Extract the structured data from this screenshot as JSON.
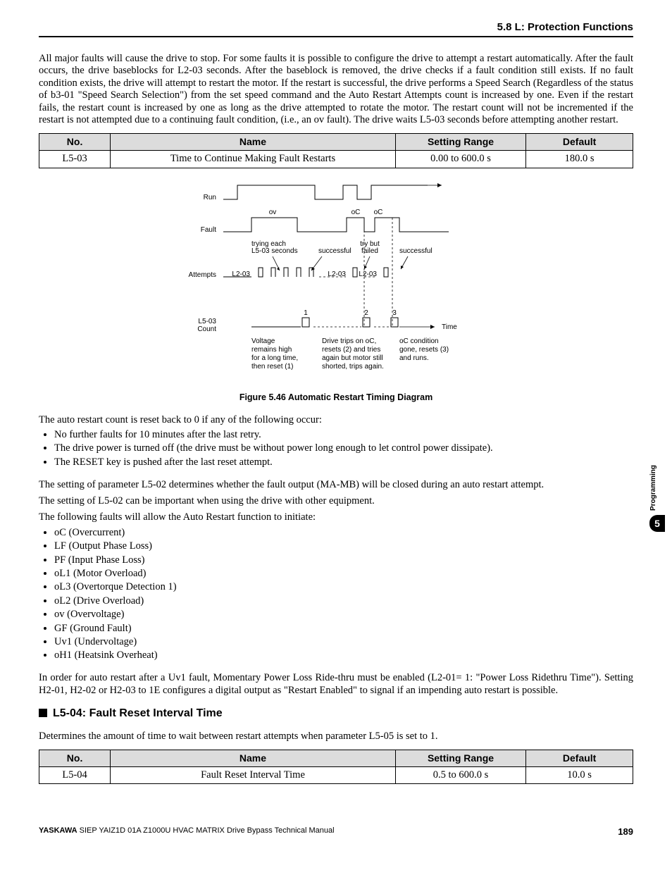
{
  "running_head": "5.8 L: Protection Functions",
  "intro_paragraph": "All major faults will cause the drive to stop. For some faults it is possible to configure the drive to attempt a restart automatically. After the fault occurs, the drive baseblocks for L2-03 seconds. After the baseblock is removed, the drive checks if a fault condition still exists. If no fault condition exists, the drive will attempt to restart the motor. If the restart is successful, the drive performs a Speed Search (Regardless of the status of b3-01 \"Speed Search Selection\") from the set speed command and the Auto Restart Attempts count is increased by one. Even if the restart fails, the restart count is increased by one as long as the drive attempted to rotate the motor. The restart count will not be incremented if the restart is not attempted due to a continuing fault condition, (i.e., an ov fault). The drive waits L5-03 seconds before attempting another restart.",
  "table1": {
    "headers": {
      "no": "No.",
      "name": "Name",
      "range": "Setting Range",
      "default": "Default"
    },
    "row": {
      "no": "L5-03",
      "name": "Time to Continue Making Fault Restarts",
      "range": "0.00 to 600.0 s",
      "default": "180.0 s"
    }
  },
  "diagram": {
    "row_labels": {
      "run": "Run",
      "fault": "Fault",
      "attempts": "Attempts",
      "count": "L5-03\nCount"
    },
    "top_labels": {
      "ov": "ov",
      "oc1": "oC",
      "oc2": "oC"
    },
    "mid_labels": {
      "trying": "trying each\nL5-03 seconds",
      "successful1": "successful",
      "trybut": "try but\nfailed",
      "successful2": "successful",
      "l2a": "L2-03",
      "l2b": "L2-03",
      "l2c": "L2-03"
    },
    "count_nums": {
      "n1": "1",
      "n2": "2",
      "n3": "3"
    },
    "time": "Time",
    "captions": {
      "c1": "Voltage\nremains high\nfor a long time,\nthen reset (1)",
      "c2": "Drive trips on oC,\nresets (2) and tries\nagain but motor still\nshorted, trips again.",
      "c3": "oC condition\ngone, resets (3)\nand runs."
    }
  },
  "figure_caption": "Figure 5.46  Automatic Restart Timing Diagram",
  "after_fig_intro": "The auto restart count is reset back to 0 if any of the following occur:",
  "reset_bullets": [
    "No further faults for 10 minutes after the last retry.",
    "The drive power is turned off (the drive must be without power long enough to let control power dissipate).",
    "The RESET key is pushed after the last reset attempt."
  ],
  "l502_line1": "The setting of parameter L5-02 determines whether the fault output (MA-MB) will be closed during an auto restart attempt.",
  "l502_line2": "The setting of L5-02 can be important when using the drive with other equipment.",
  "faults_intro": "The following faults will allow the Auto Restart function to initiate:",
  "fault_bullets": [
    "oC (Overcurrent)",
    "LF (Output Phase Loss)",
    "PF (Input Phase Loss)",
    "oL1 (Motor Overload)",
    "oL3 (Overtorque Detection 1)",
    "oL2 (Drive Overload)",
    "ov (Overvoltage)",
    "GF (Ground Fault)",
    "Uv1 (Undervoltage)",
    "oH1 (Heatsink Overheat)"
  ],
  "uv1_note": "In order for auto restart after a Uv1 fault, Momentary Power Loss Ride-thru must be enabled (L2-01= 1: \"Power Loss Ridethru Time\"). Setting H2-01, H2-02 or H2-03 to 1E configures a digital output as \"Restart Enabled\" to signal if an impending auto restart is possible.",
  "section2": {
    "heading": "L5-04: Fault Reset Interval Time",
    "body": "Determines the amount of time to wait between restart attempts when parameter L5-05 is set to 1."
  },
  "table2": {
    "headers": {
      "no": "No.",
      "name": "Name",
      "range": "Setting Range",
      "default": "Default"
    },
    "row": {
      "no": "L5-04",
      "name": "Fault Reset Interval Time",
      "range": "0.5 to 600.0 s",
      "default": "10.0 s"
    }
  },
  "side": {
    "label": "Programming",
    "num": "5"
  },
  "footer": {
    "left_bold": "YASKAWA",
    "left_rest": " SIEP YAIZ1D 01A Z1000U HVAC MATRIX Drive Bypass Technical Manual",
    "page": "189"
  }
}
